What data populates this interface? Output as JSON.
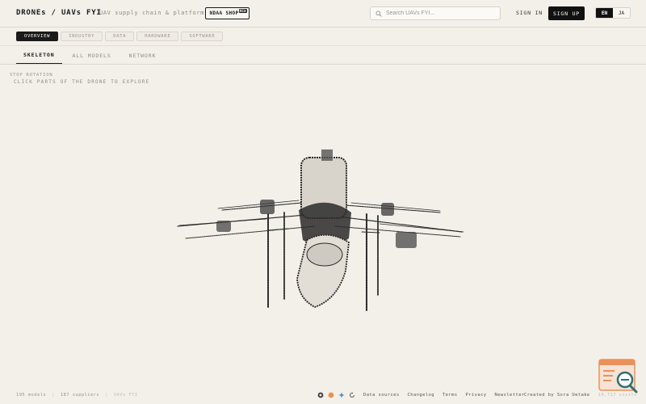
{
  "header": {
    "brand": "DRONEs / UAVs FYI",
    "tagline": "UAV supply chain & platforms",
    "ndaa_label": "NDAA SHOP",
    "ndaa_badge": "NEW",
    "search_placeholder": "Search UAVs FYI...",
    "sign_in": "SIGN IN",
    "sign_up": "SIGN UP",
    "languages": [
      "EN",
      "JA"
    ],
    "active_language": "EN"
  },
  "categories": [
    "OVERVIEW",
    "INDUSTRY",
    "DATA",
    "HARDWARE",
    "SOFTWARE"
  ],
  "active_category": "OVERVIEW",
  "views": [
    "SKELETON",
    "ALL MODELS",
    "NETWORK"
  ],
  "active_view": "SKELETON",
  "canvas": {
    "stop_rotation": "STOP ROTATION",
    "hint": "CLICK PARTS OF THE DRONE TO EXPLORE"
  },
  "footer": {
    "models": "195 models",
    "suppliers": "187 suppliers",
    "site": "UAVs FYI",
    "links": [
      "Data sources",
      "Changelog",
      "Terms",
      "Privacy",
      "Newsletter"
    ],
    "created_by": "Created by Sora Uetake",
    "visits": "10,717 visits",
    "icons": [
      "github-icon",
      "producthunt-icon",
      "sparkle-icon",
      "refresh-icon"
    ]
  },
  "colors": {
    "background": "#f3f0ea",
    "text": "#1f1f1f",
    "muted": "#9a958c",
    "accent_dark": "#111111",
    "widget_orange": "#e9915a",
    "widget_teal": "#2f6f73"
  }
}
